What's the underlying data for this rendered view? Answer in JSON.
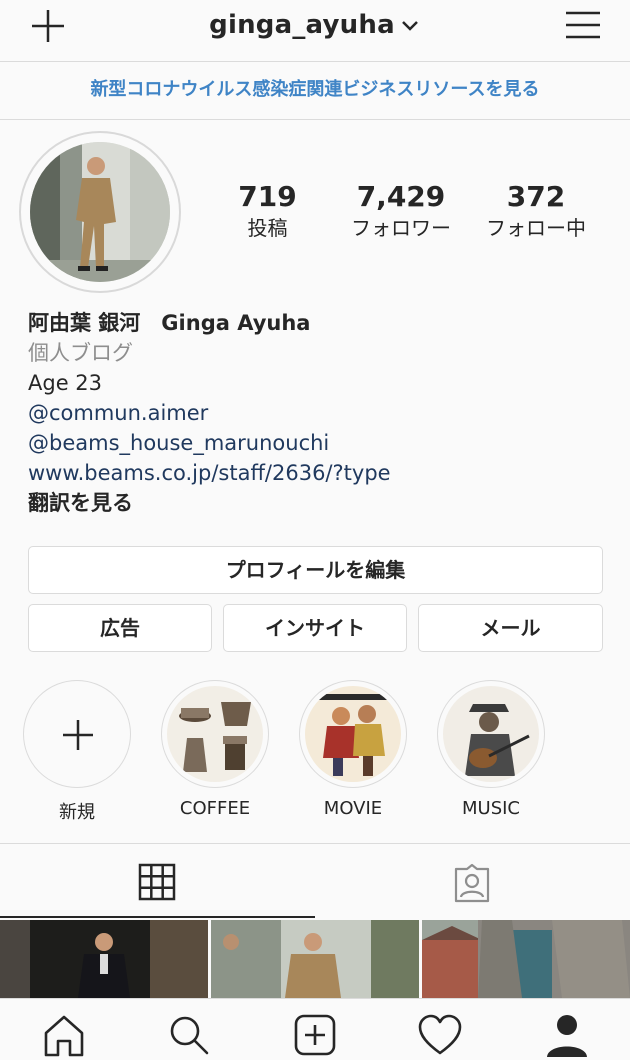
{
  "header": {
    "username": "ginga_ayuha",
    "new_post_icon": "plus-icon",
    "menu_icon": "hamburger-menu-icon"
  },
  "banner": {
    "text": "新型コロナウイルス感染症関連ビジネスリソースを見る"
  },
  "stats": [
    {
      "value": "719",
      "label": "投稿"
    },
    {
      "value": "7,429",
      "label": "フォロワー"
    },
    {
      "value": "372",
      "label": "フォロー中"
    }
  ],
  "bio": {
    "name": "阿由葉 銀河　Ginga Ayuha",
    "category": "個人ブログ",
    "line1": "Age 23",
    "mention1": "@commun.aimer",
    "mention2": "@beams_house_marunouchi",
    "website": "www.beams.co.jp/staff/2636/?type",
    "translate": "翻訳を見る"
  },
  "buttons": {
    "edit_profile": "プロフィールを編集",
    "ads": "広告",
    "insights": "インサイト",
    "email": "メール"
  },
  "highlights": [
    {
      "label": "新規"
    },
    {
      "label": "COFFEE"
    },
    {
      "label": "MOVIE"
    },
    {
      "label": "MUSIC"
    }
  ],
  "colors": {
    "banner_text": "#3f84c6",
    "link": "#20395e",
    "muted": "#8e8e8e",
    "border": "#dbdbdb"
  }
}
